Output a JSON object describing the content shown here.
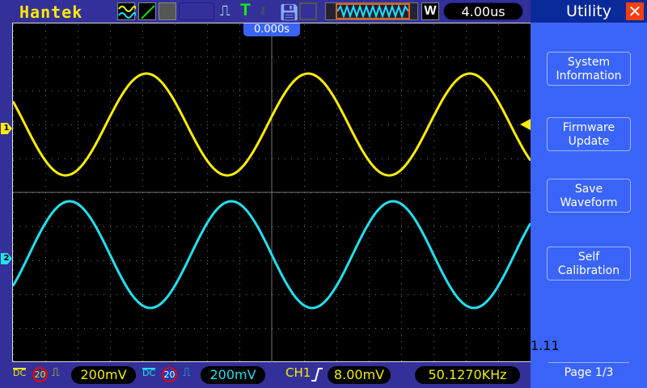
{
  "brand": "Hantek",
  "trigger_position": "0.000s",
  "timebase": "4.00us",
  "window_mode": "W",
  "menu": {
    "title": "Utility",
    "close_icon": "close-icon",
    "items": [
      {
        "line1": "System",
        "line2": "Information"
      },
      {
        "line1": "Firmware",
        "line2": "Update"
      },
      {
        "line1": "Save",
        "line2": "Waveform"
      },
      {
        "line1": "Self",
        "line2": "Calibration"
      }
    ],
    "page": "Page 1/3",
    "overlay": "1.11"
  },
  "channels": [
    {
      "marker": "1",
      "coupling": "DC",
      "bw_limit": "20",
      "scale": "200mV",
      "color": "#ffee00"
    },
    {
      "marker": "2",
      "coupling": "DC",
      "bw_limit": "20",
      "scale": "200mV",
      "color": "#22e0ee"
    }
  ],
  "trigger": {
    "source": "CH1",
    "edge": "rising",
    "level": "8.00mV"
  },
  "frequency": "50.1270KHz",
  "colors": {
    "background": "#33309a",
    "menu": "#3a64f8",
    "ch1": "#ffee00",
    "ch2": "#22e0ee"
  }
}
